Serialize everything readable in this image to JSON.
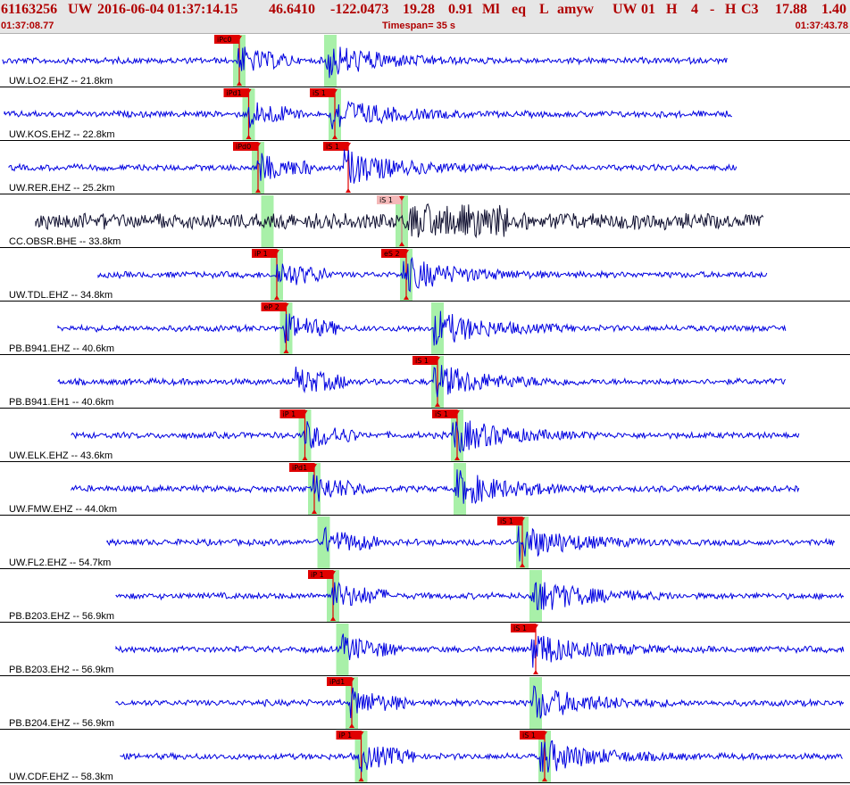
{
  "header": {
    "event_id": "61163256",
    "network": "UW",
    "datetime": "2016-06-04 01:37:14.15",
    "latitude": "46.6410",
    "longitude": "-122.0473",
    "depth": "19.28",
    "magnitude": "0.91",
    "mag_type": "Ml",
    "event_type": "eq",
    "location_type": "L",
    "author": "amyw",
    "solution_net": "UW",
    "version": "01",
    "status": "H",
    "nph": "4",
    "dash": "-",
    "quality": "H",
    "gap_code": "C3",
    "value_a": "17.88",
    "value_b": "1.40",
    "start_time": "01:37:08.77",
    "timespan": "Timespan=  35 s",
    "end_time": "01:37:43.78"
  },
  "colors": {
    "header_bg": "#e6e6e6",
    "header_text": "#b00000",
    "trace_blue": "#0000e0",
    "trace_black": "#101030",
    "pick_red": "#e00000",
    "pick_pink": "#f4b8b8",
    "pick_window_green": "#a8f0a8",
    "separator": "#000000"
  },
  "traces": [
    {
      "label": "UW.LO2.EHZ -- 21.8km",
      "color": "blue",
      "picks": [
        {
          "label": "iPc0",
          "time": 1.5,
          "window": true,
          "style": "red"
        },
        {
          "label": "",
          "time": 1.5,
          "window": false,
          "style": "none",
          "s_window": 4.0
        }
      ]
    },
    {
      "label": "UW.KOS.EHZ -- 22.8km",
      "color": "blue",
      "picks": [
        {
          "label": "iPd1",
          "time": 1.5,
          "window": true,
          "style": "red"
        },
        {
          "label": "iS 1",
          "time": 4.2,
          "window": true,
          "style": "red"
        }
      ]
    },
    {
      "label": "UW.RER.EHZ -- 25.2km",
      "color": "blue",
      "picks": [
        {
          "label": "iPd0",
          "time": 1.8,
          "window": true,
          "style": "red"
        },
        {
          "label": "iS 1",
          "time": 4.3,
          "window": false,
          "style": "red"
        }
      ]
    },
    {
      "label": "CC.OBSR.BHE -- 33.8km",
      "color": "black",
      "picks": [
        {
          "label": "",
          "time": 3.5,
          "window": true,
          "style": "none"
        },
        {
          "label": "iS 1",
          "time": 4.2,
          "window": true,
          "style": "pink"
        }
      ]
    },
    {
      "label": "UW.TDL.EHZ -- 34.8km",
      "color": "blue",
      "picks": [
        {
          "label": "iP 1",
          "time": 3.1,
          "window": true,
          "style": "red"
        },
        {
          "label": "eS 2",
          "time": 5.9,
          "window": true,
          "style": "red"
        }
      ]
    },
    {
      "label": "PB.B941.EHZ -- 40.6km",
      "color": "blue",
      "picks": [
        {
          "label": "eP 2",
          "time": 3.6,
          "window": true,
          "style": "red"
        },
        {
          "label": "",
          "time": 6.4,
          "window": true,
          "style": "none"
        }
      ]
    },
    {
      "label": "PB.B941.EH1 -- 40.6km",
      "color": "blue",
      "picks": [
        {
          "label": "",
          "time": 3.5,
          "window": false,
          "style": "none"
        },
        {
          "label": "iS 1",
          "time": 6.6,
          "window": true,
          "style": "red"
        }
      ]
    },
    {
      "label": "UW.ELK.EHZ -- 43.6km",
      "color": "blue",
      "picks": [
        {
          "label": "iP 1",
          "time": 3.8,
          "window": true,
          "style": "red"
        },
        {
          "label": "iS 1",
          "time": 7.1,
          "window": true,
          "style": "red"
        }
      ]
    },
    {
      "label": "UW.FMW.EHZ -- 44.0km",
      "color": "blue",
      "picks": [
        {
          "label": "iPd1",
          "time": 3.8,
          "window": true,
          "style": "red"
        },
        {
          "label": "",
          "time": 7.2,
          "window": true,
          "style": "none"
        }
      ]
    },
    {
      "label": "UW.FL2.EHZ -- 54.7km",
      "color": "blue",
      "picks": [
        {
          "label": "",
          "time": 4.3,
          "window": true,
          "style": "none"
        },
        {
          "label": "iS 1",
          "time": 8.4,
          "window": true,
          "style": "red"
        }
      ]
    },
    {
      "label": "PB.B203.EHZ -- 56.9km",
      "color": "blue",
      "picks": [
        {
          "label": "iP 1",
          "time": 4.4,
          "window": true,
          "style": "red"
        },
        {
          "label": "",
          "time": 8.6,
          "window": true,
          "style": "none"
        }
      ]
    },
    {
      "label": "PB.B203.EH2 -- 56.9km",
      "color": "blue",
      "picks": [
        {
          "label": "",
          "time": 4.4,
          "window": true,
          "style": "none"
        },
        {
          "label": "iS 1",
          "time": 8.6,
          "window": false,
          "style": "red"
        }
      ]
    },
    {
      "label": "PB.B204.EHZ -- 56.9km",
      "color": "blue",
      "picks": [
        {
          "label": "iPd1",
          "time": 4.4,
          "window": true,
          "style": "red"
        },
        {
          "label": "",
          "time": 8.6,
          "window": true,
          "style": "none"
        }
      ]
    },
    {
      "label": "UW.CDF.EHZ -- 58.3km",
      "color": "blue",
      "picks": [
        {
          "label": "iP 1",
          "time": 4.5,
          "window": true,
          "style": "red"
        },
        {
          "label": "iS 1",
          "time": 8.8,
          "window": true,
          "style": "red"
        }
      ]
    }
  ]
}
